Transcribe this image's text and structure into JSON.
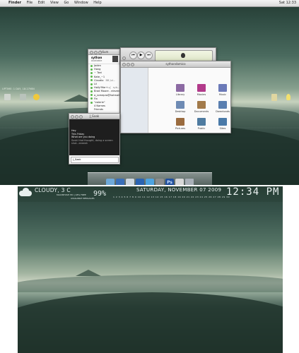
{
  "menubar": {
    "apple": "",
    "items": [
      "Finder",
      "File",
      "Edit",
      "View",
      "Go",
      "Window",
      "Help"
    ],
    "clock": "Sat 12:33"
  },
  "desktop_left_label": "UPTIME: 1 DAY, 18:27MIN",
  "adium": {
    "title": "Adium",
    "user_name": "sythan",
    "user_status": "Available",
    "buddies": [
      "Jaden",
      "Hong",
      "~ Toni",
      "Kate_~1",
      "Claudio",
      "Lil",
      "Holly'Mar+:-(",
      "Brad Moore - eleven",
      "a_romepro@hotmail",
      "Fin",
      "\"valerie\"",
      "4 Names",
      "Friends"
    ],
    "buddy_side": [
      "",
      "",
      "",
      "",
      "BB Jul...",
      "",
      "syb...",
      "",
      "",
      "",
      "",
      "",
      ""
    ]
  },
  "itunes": {
    "title": "",
    "controls": [
      "prev",
      "play",
      "next"
    ]
  },
  "finder": {
    "title": "sythandamico",
    "items": [
      "Library",
      "Movies",
      "Music",
      "Desktop",
      "Documents",
      "Downloads",
      "Pictures",
      "Public",
      "Sites"
    ],
    "item_colors": [
      "#8c6aa3",
      "#b23a8a",
      "#6b7ab8",
      "#6e8bb4",
      "#a27a4a",
      "#5a7fb0",
      "#9a6b3e",
      "#4e7ba0",
      "#4a7aa8"
    ]
  },
  "chat": {
    "title": "J_Gaak",
    "lines": [
      "Hey",
      "This Friday",
      "What are you doing",
      "Sushi that thought, doing a screen shot...eeeeek"
    ],
    "input_placeholder": "J_Gaak"
  },
  "dock_colors": [
    "#6fa9d8",
    "#3a6fb8",
    "#cfd8e0",
    "#2b63b1",
    "#4ea3e0",
    "#8e8e8e",
    "#1f4f9e",
    "#d8d8d8",
    "#a9b0b8"
  ],
  "dock_ps": "Ps",
  "geektool": {
    "weather": "CLOUDY, 3 C",
    "sub_line1": "MACINTOSH HD | 18% FREE",
    "sub_line2": "AVAILABLE MESSAGES",
    "percent": "99%",
    "date": "SATURDAY, NOVEMBER 07 2009",
    "calendar": "1 2 3 4 5 6 7 8 9 10 11 12 13 14 15 16 17 18 19 20 21 22 23 24 25 26 27 28 29 30",
    "time": "12:34 PM"
  }
}
